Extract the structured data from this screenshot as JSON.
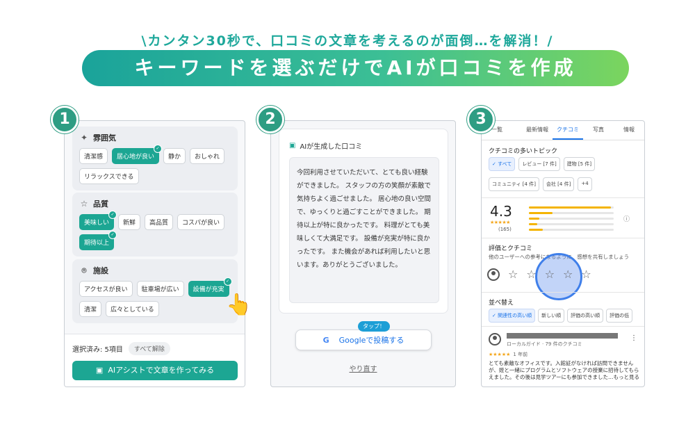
{
  "header": {
    "tagline": "\\カンタン30秒で、口コミの文章を考えるのが面倒…を解消！/",
    "banner": "キーワードを選ぶだけでAIが口コミを作成"
  },
  "steps": [
    "1",
    "2",
    "3"
  ],
  "panel1": {
    "categories": [
      {
        "title": "雰囲気",
        "icon": "sparkle-icon",
        "chips": [
          {
            "label": "清潔感",
            "selected": false
          },
          {
            "label": "居心地が良い",
            "selected": true
          },
          {
            "label": "静か",
            "selected": false
          },
          {
            "label": "おしゃれ",
            "selected": false
          },
          {
            "label": "リラックスできる",
            "selected": false
          }
        ]
      },
      {
        "title": "品質",
        "icon": "star-outline-icon",
        "chips": [
          {
            "label": "美味しい",
            "selected": true
          },
          {
            "label": "新鮮",
            "selected": false
          },
          {
            "label": "高品質",
            "selected": false
          },
          {
            "label": "コスパが良い",
            "selected": false
          },
          {
            "label": "期待以上",
            "selected": true
          }
        ]
      },
      {
        "title": "施設",
        "icon": "location-pin-icon",
        "chips": [
          {
            "label": "アクセスが良い",
            "selected": false
          },
          {
            "label": "駐車場が広い",
            "selected": false
          },
          {
            "label": "設備が充実",
            "selected": true
          },
          {
            "label": "清潔",
            "selected": false
          },
          {
            "label": "広々としている",
            "selected": false
          }
        ]
      }
    ],
    "selected_count": "選択済み: 5項目",
    "clear_all": "すべて解除",
    "ai_button": "AIアシストで文章を作ってみる"
  },
  "panel2": {
    "heading": "AIが生成した口コミ",
    "generated_text": "今回利用させていただいて、とても良い経験ができました。 スタッフの方の笑顔が素敵で気持ちよく過ごせました。 居心地の良い空間で、ゆっくりと過ごすことができました。 期待以上が特に良かったです。 料理がとても美味しくて大満足です。 設備が充実が特に良かったです。 また機会があれば利用したいと思います。ありがとうございました。",
    "tap_badge": "タップ！",
    "post_button_icon": "G",
    "post_button": "Googleで投稿する",
    "redo": "やり直す"
  },
  "panel3": {
    "tabs": [
      "一覧",
      "最新情報",
      "クチコミ",
      "写真",
      "情報"
    ],
    "active_tab": 2,
    "topics_title": "クチコミの多いトピック",
    "topic_chips_row1": [
      "✓ すべて",
      "レビュー [7 件]",
      "建物 [5 件]"
    ],
    "topic_chips_row2": [
      "コミュニティ [4 件]",
      "会社 [4 件]",
      "+4"
    ],
    "rating": "4.3",
    "rating_stars": "★★★★★",
    "rating_count": "(165)",
    "rating_bars": [
      0.97,
      0.28,
      0.12,
      0.1,
      0.16
    ],
    "eval_title": "評価とクチコミ",
    "eval_sub": "他のユーザーへの参考になるように、感想を共有しましょう",
    "eval_stars": [
      "☆",
      "☆",
      "☆",
      "☆",
      "☆"
    ],
    "sort_title": "並べ替え",
    "sort_chips": [
      "✓ 関連性の高い順",
      "新しい順",
      "評価の高い順",
      "評価の低"
    ],
    "review_meta": "ローカルガイド · 79 件のクチコミ",
    "review_stars": "★★★★★",
    "review_date": "1 年前",
    "review_body": "とても素敵なオフィスです。入館証がなければ訪問できませんが、姪と一緒にプログラムとソフトウェアの授業に招待してもらえました。その後は見学ツアーにも参加できました…もっと見る"
  }
}
